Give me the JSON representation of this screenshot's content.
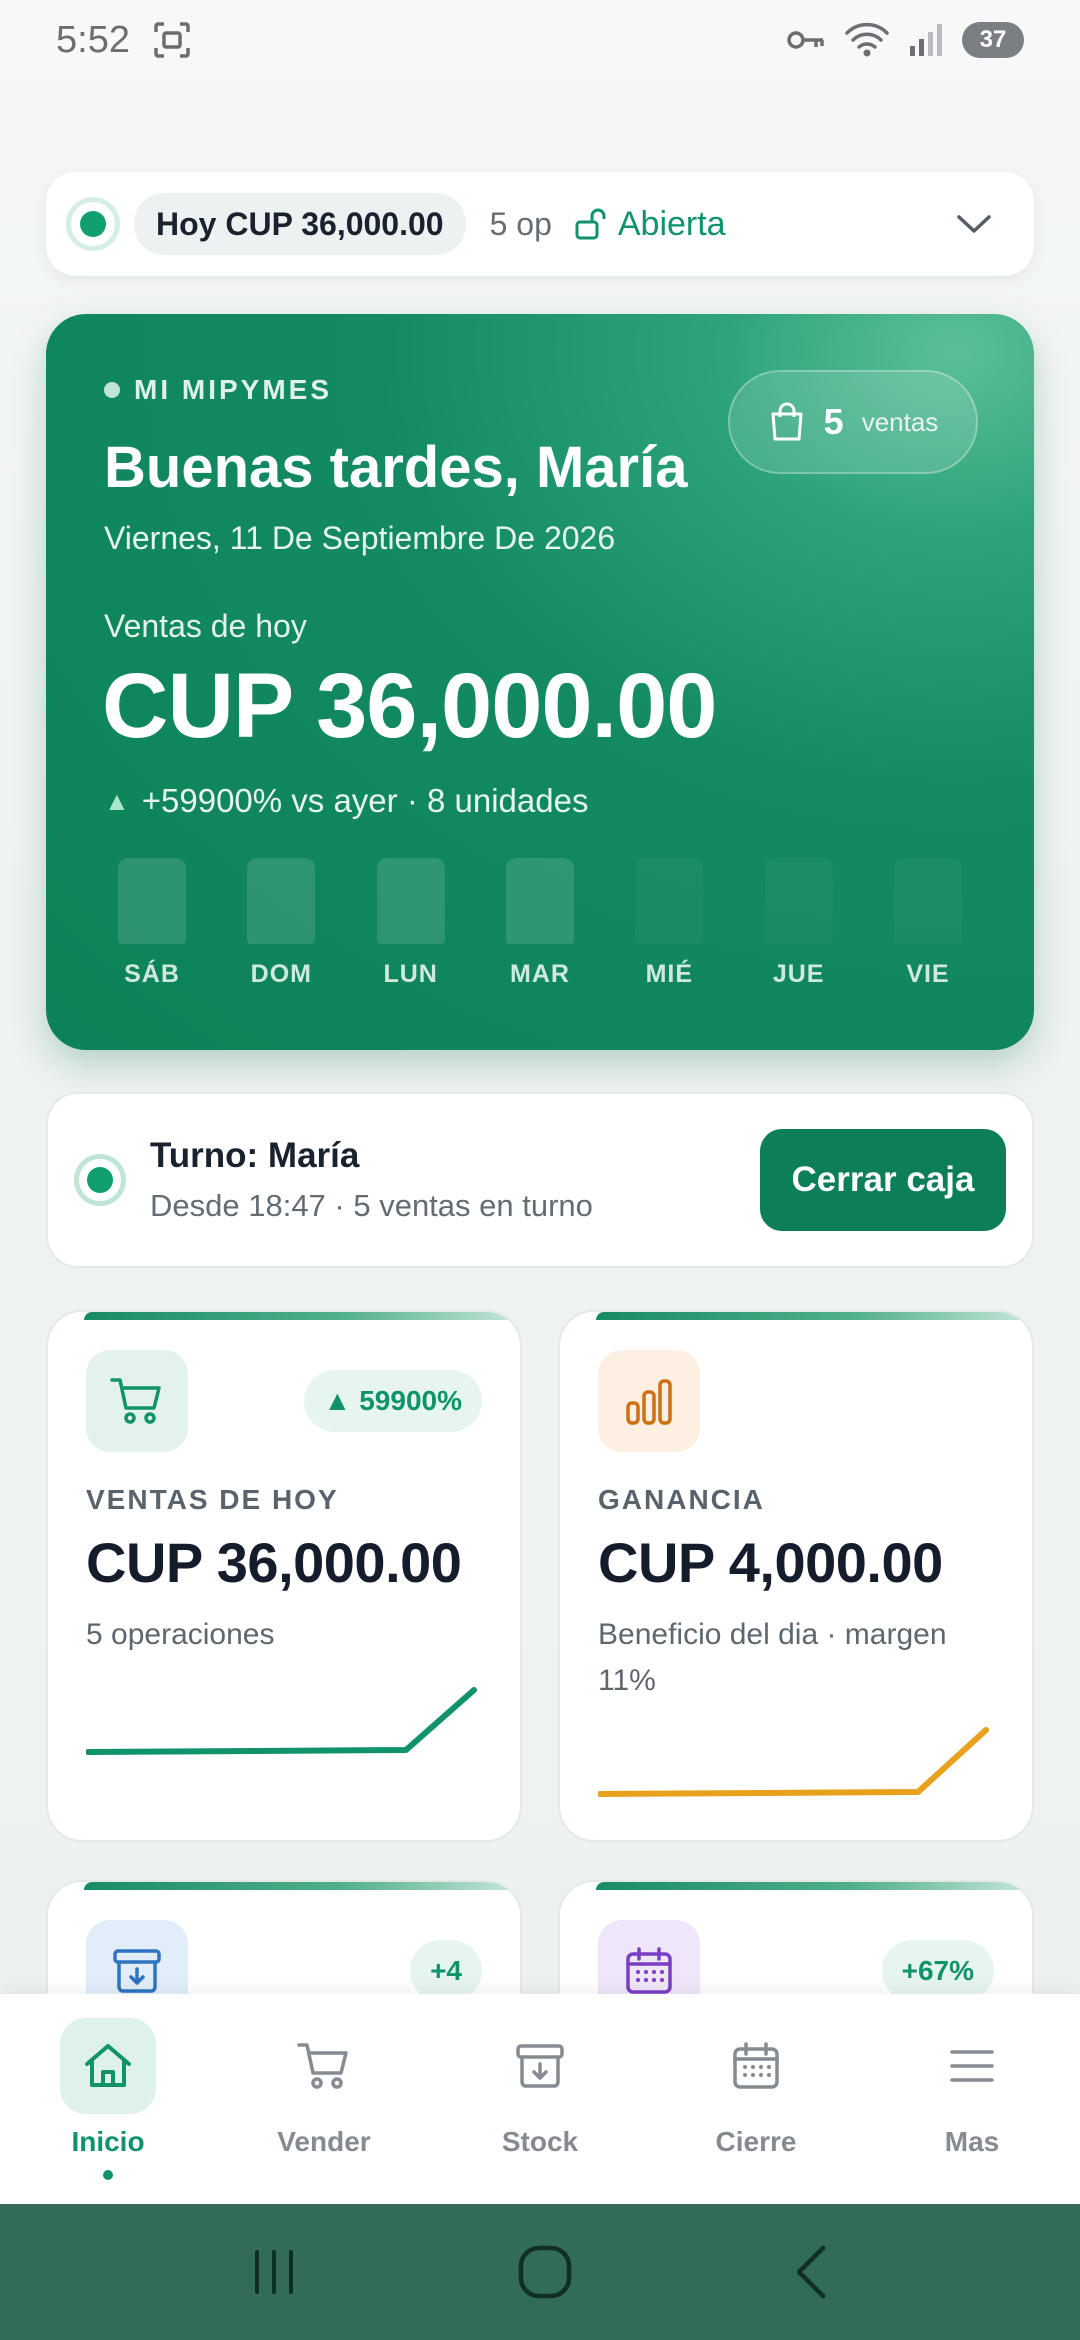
{
  "status_bar": {
    "time": "5:52",
    "battery": "37"
  },
  "summary_bar": {
    "today": "Hoy CUP 36,000.00",
    "ops": "5 op",
    "state": "Abierta"
  },
  "hero": {
    "brand": "MI MIPYMES",
    "greeting": "Buenas tardes, María",
    "date": "Viernes, 11 De Septiembre De 2026",
    "sales_count": "5",
    "sales_label": "ventas",
    "label": "Ventas de hoy",
    "amount": "CUP 36,000.00",
    "delta": "+59900% vs ayer · 8 unidades",
    "days": [
      "SÁB",
      "DOM",
      "LUN",
      "MAR",
      "MIÉ",
      "JUE",
      "VIE"
    ]
  },
  "shift": {
    "title": "Turno: María",
    "subtitle": "Desde 18:47 · 5 ventas en turno",
    "close_button": "Cerrar caja"
  },
  "cards": {
    "sales": {
      "badge": "59900%",
      "title": "VENTAS DE HOY",
      "value": "CUP 36,000.00",
      "sub": "5 operaciones",
      "color": "#10936a"
    },
    "profit": {
      "title": "GANANCIA",
      "value": "CUP 4,000.00",
      "sub": "Beneficio del dia · margen 11%",
      "color": "#e8a11c"
    },
    "stock": {
      "badge": "+4"
    },
    "calendar": {
      "badge": "+67%"
    }
  },
  "nav": {
    "items": [
      {
        "label": "Inicio"
      },
      {
        "label": "Vender"
      },
      {
        "label": "Stock"
      },
      {
        "label": "Cierre"
      },
      {
        "label": "Mas"
      }
    ]
  },
  "colors": {
    "accent": "#10936a",
    "hero": "#0d8257",
    "system_nav": "#336b5b"
  }
}
